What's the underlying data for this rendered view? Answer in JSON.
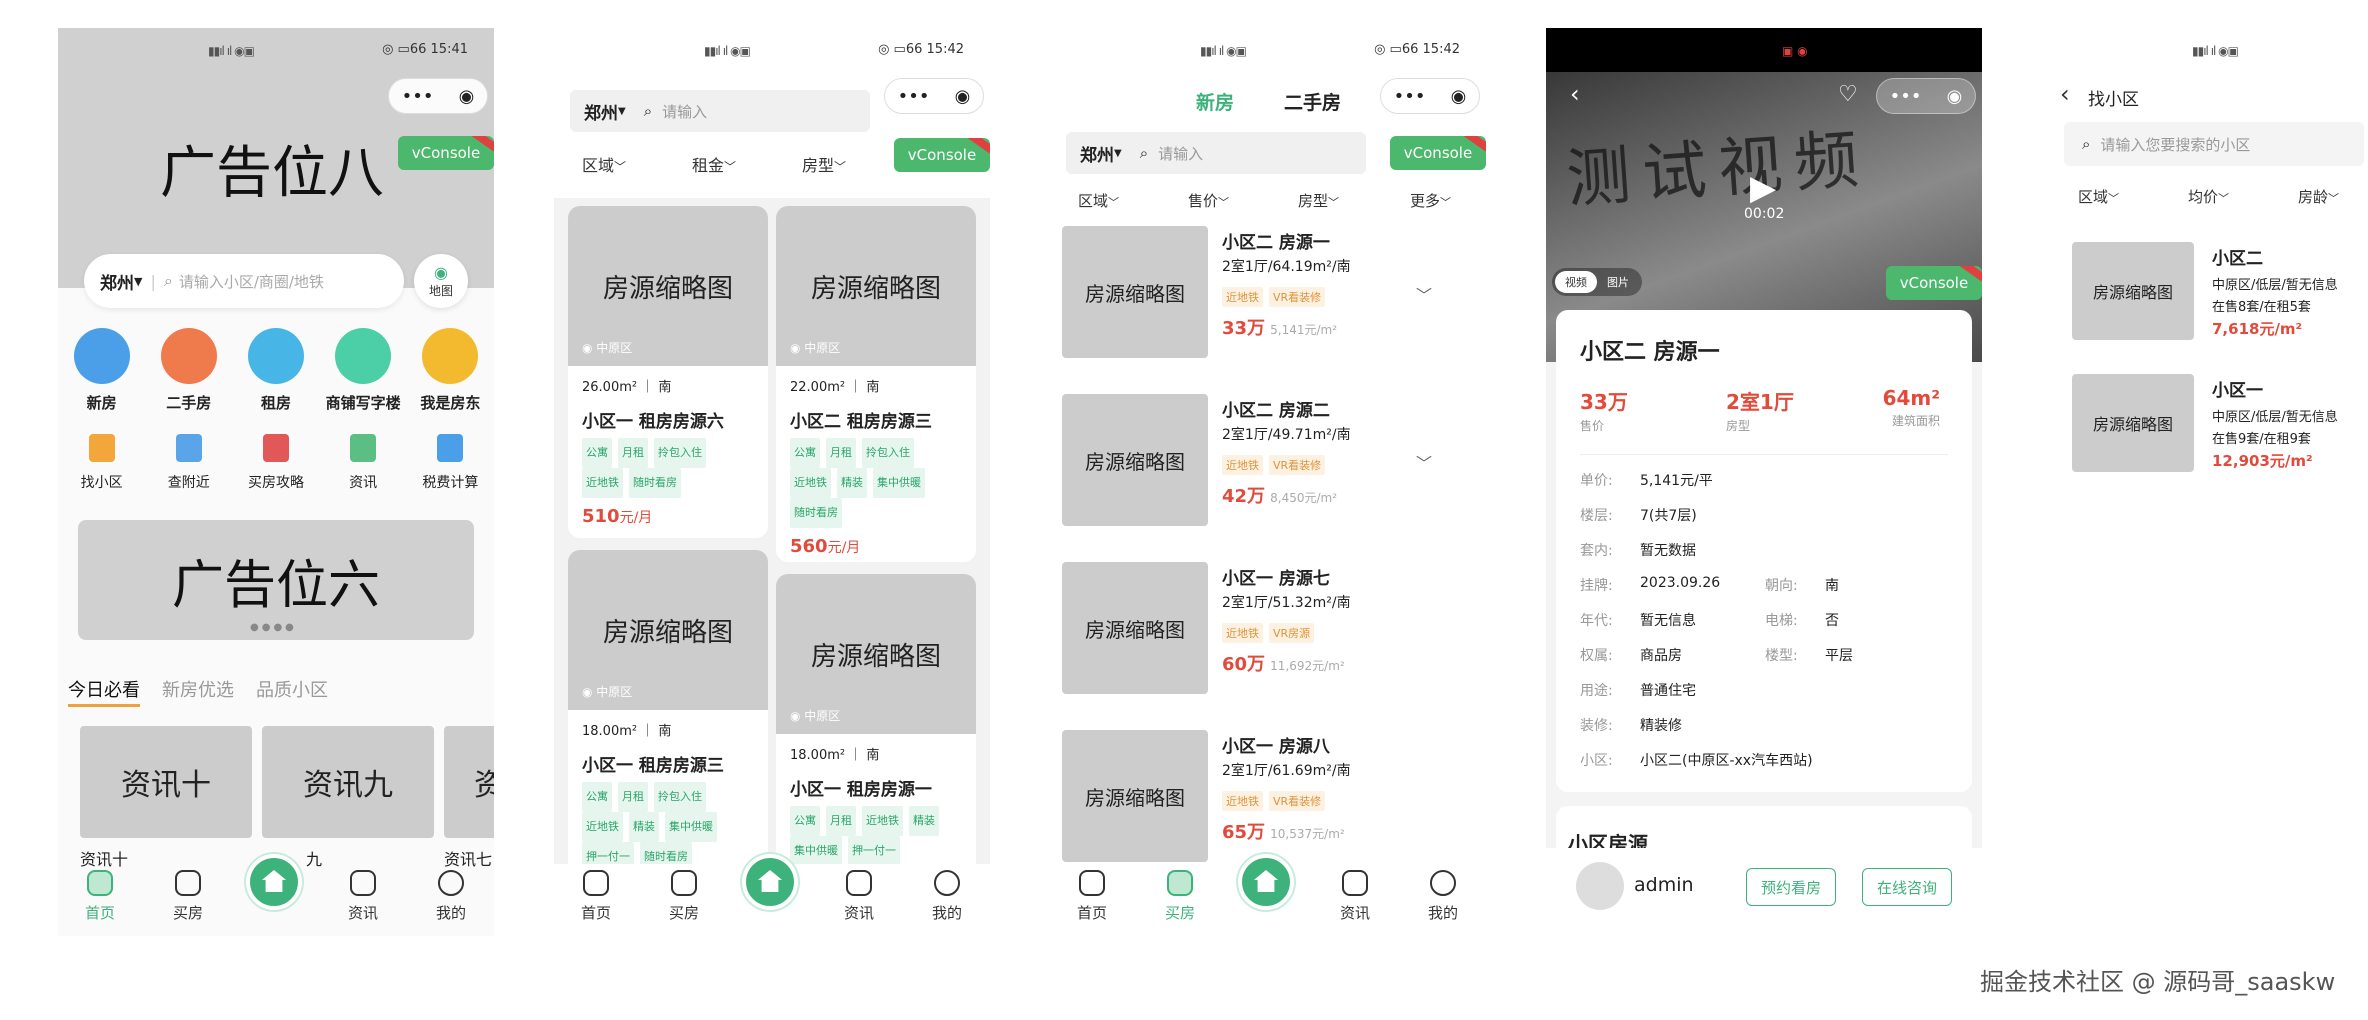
{
  "screen1": {
    "time": "15:41",
    "battery": "66",
    "ad_top": "广告位八",
    "vconsole": "vConsole",
    "city": "郑州",
    "search_placeholder": "请输入小区/商圈/地铁",
    "map": "地图",
    "big_icons": [
      "新房",
      "二手房",
      "租房",
      "商铺写字楼",
      "我是房东"
    ],
    "small_icons": [
      "找小区",
      "查附近",
      "买房攻略",
      "资讯",
      "税费计算"
    ],
    "ad_mid": "广告位六",
    "tabs": [
      "今日必看",
      "新房优选",
      "品质小区"
    ],
    "news": [
      {
        "thumb": "资讯十",
        "caption": "资讯十"
      },
      {
        "thumb": "资讯九",
        "caption": "九"
      },
      {
        "thumb": "资",
        "caption": "资讯七"
      }
    ]
  },
  "screen2": {
    "time": "15:42",
    "battery": "66",
    "city": "郑州",
    "search_placeholder": "请输入",
    "filters": [
      "区域",
      "租金",
      "房型"
    ],
    "vconsole": "vConsole",
    "cards": [
      {
        "thumb": "房源缩略图",
        "district": "中原区",
        "area": "26.00m²",
        "orient": "南",
        "title": "小区一 租房房源六",
        "tags": [
          "公寓",
          "月租",
          "拎包入住",
          "近地铁",
          "随时看房"
        ],
        "price": "510",
        "unit": "元/月"
      },
      {
        "thumb": "房源缩略图",
        "district": "中原区",
        "area": "22.00m²",
        "orient": "南",
        "title": "小区二 租房房源三",
        "tags": [
          "公寓",
          "月租",
          "拎包入住",
          "近地铁",
          "精装",
          "集中供暖",
          "随时看房"
        ],
        "price": "560",
        "unit": "元/月"
      },
      {
        "thumb": "房源缩略图",
        "district": "中原区",
        "area": "18.00m²",
        "orient": "南",
        "title": "小区一 租房房源三",
        "tags": [
          "公寓",
          "月租",
          "拎包入住",
          "近地铁",
          "精装",
          "集中供暖",
          "押一付一",
          "随时看房"
        ],
        "price": "",
        "unit": ""
      },
      {
        "thumb": "房源缩略图",
        "district": "中原区",
        "area": "18.00m²",
        "orient": "南",
        "title": "小区一 租房房源一",
        "tags": [
          "公寓",
          "月租",
          "近地铁",
          "精装",
          "集中供暖",
          "押一付一"
        ],
        "price": "",
        "unit": ""
      }
    ]
  },
  "screen3": {
    "time": "15:42",
    "battery": "66",
    "tab_new": "新房",
    "tab_second": "二手房",
    "city": "郑州",
    "search_placeholder": "请输入",
    "vconsole": "vConsole",
    "filters": [
      "区域",
      "售价",
      "房型",
      "更多"
    ],
    "items": [
      {
        "thumb": "房源缩略图",
        "title": "小区二 房源一",
        "spec": "2室1厅/64.19m²/南",
        "tags": [
          "近地铁",
          "VR看装修"
        ],
        "price": "33万",
        "unit_price": "5,141元/m²"
      },
      {
        "thumb": "房源缩略图",
        "title": "小区二 房源二",
        "spec": "2室1厅/49.71m²/南",
        "tags": [
          "近地铁",
          "VR看装修"
        ],
        "price": "42万",
        "unit_price": "8,450元/m²"
      },
      {
        "thumb": "房源缩略图",
        "title": "小区一 房源七",
        "spec": "2室1厅/51.32m²/南",
        "tags": [
          "近地铁",
          "VR房源"
        ],
        "price": "60万",
        "unit_price": "11,692元/m²"
      },
      {
        "thumb": "房源缩略图",
        "title": "小区一 房源八",
        "spec": "2室1厅/61.69m²/南",
        "tags": [
          "近地铁",
          "VR看装修"
        ],
        "price": "65万",
        "unit_price": "10,537元/m²"
      }
    ]
  },
  "screen4": {
    "video_text": "测试视频",
    "video_time": "00:02",
    "media_tabs": [
      "视频",
      "图片"
    ],
    "vconsole": "vConsole",
    "title": "小区二 房源一",
    "stats": [
      {
        "value": "33万",
        "label": "售价"
      },
      {
        "value": "2室1厅",
        "label": "房型"
      },
      {
        "value": "64m²",
        "label": "建筑面积"
      }
    ],
    "rows": [
      {
        "k1": "单价:",
        "v1": "5,141元/平",
        "k2": "",
        "v2": ""
      },
      {
        "k1": "楼层:",
        "v1": "7(共7层)",
        "k2": "",
        "v2": ""
      },
      {
        "k1": "套内:",
        "v1": "暂无数据",
        "k2": "",
        "v2": ""
      },
      {
        "k1": "挂牌:",
        "v1": "2023.09.26",
        "k2": "朝向:",
        "v2": "南"
      },
      {
        "k1": "年代:",
        "v1": "暂无信息",
        "k2": "电梯:",
        "v2": "否"
      },
      {
        "k1": "权属:",
        "v1": "商品房",
        "k2": "楼型:",
        "v2": "平层"
      },
      {
        "k1": "用途:",
        "v1": "普通住宅",
        "k2": "",
        "v2": ""
      },
      {
        "k1": "装修:",
        "v1": "精装修",
        "k2": "",
        "v2": ""
      },
      {
        "k1": "小区:",
        "v1": "小区二(中原区-xx汽车西站)",
        "k2": "",
        "v2": ""
      }
    ],
    "section": "小区房源",
    "agent": "admin",
    "btn_book": "预约看房",
    "btn_consult": "在线咨询"
  },
  "screen5": {
    "title": "找小区",
    "search_placeholder": "请输入您要搜索的小区",
    "filters": [
      "区域",
      "均价",
      "房龄"
    ],
    "items": [
      {
        "thumb": "房源缩略图",
        "name": "小区二",
        "info": "中原区/低层/暂无信息",
        "stock": "在售8套/在租5套",
        "price": "7,618元/m²"
      },
      {
        "thumb": "房源缩略图",
        "name": "小区一",
        "info": "中原区/低层/暂无信息",
        "stock": "在售9套/在租9套",
        "price": "12,903元/m²"
      }
    ]
  },
  "nav": {
    "home": "首页",
    "buy": "买房",
    "news": "资讯",
    "mine": "我的"
  },
  "watermark": "掘金技术社区 @ 源码哥_saaskw",
  "colors": {
    "accent": "#3db37b",
    "price": "#e24a3b",
    "vconsole": "#4cb86e"
  }
}
